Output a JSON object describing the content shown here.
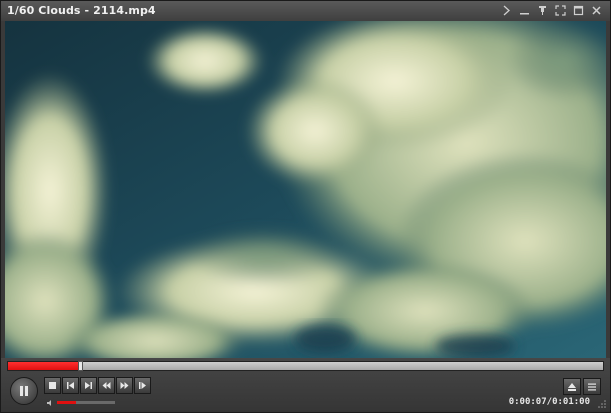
{
  "window": {
    "title": "1/60 Clouds - 2114.mp4",
    "titlebar_icons": [
      "chevron-right-icon",
      "minimize-icon",
      "pin-icon",
      "fullscreen-icon",
      "maximize-icon",
      "close-icon"
    ]
  },
  "playback": {
    "progress_fraction": 0.117,
    "volume_fraction": 0.33,
    "state": "playing",
    "time_display": "0:00:07/0:01:00"
  },
  "controls": {
    "buttons": [
      "pause-icon",
      "stop-icon",
      "previous-icon",
      "next-icon",
      "rewind-icon",
      "fast-forward-icon",
      "step-forward-icon"
    ],
    "right_buttons": [
      "eject-icon",
      "playlist-icon"
    ]
  },
  "colors": {
    "accent": "#e01010",
    "titlebar": "#4a4a4a",
    "panel": "#3d3d3d"
  }
}
